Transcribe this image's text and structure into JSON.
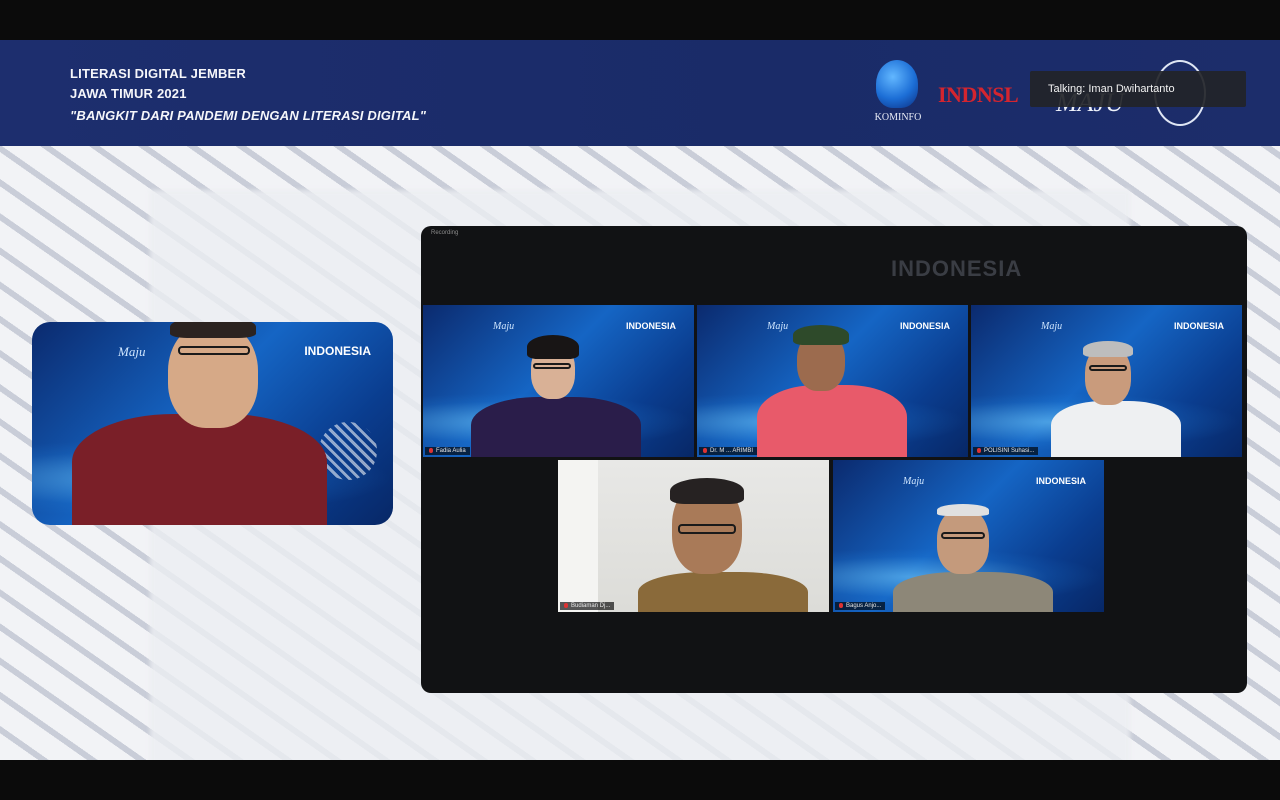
{
  "banner": {
    "line1": "LITERASI DIGITAL JEMBER",
    "line2": "JAWA TIMUR 2021",
    "line3": "\"BANGKIT DARI PANDEMI DENGAN LITERASI DIGITAL\"",
    "logos": {
      "kominfo": "KOMINFO",
      "siberkreasi": "INDNSL",
      "maju": "MAJU"
    }
  },
  "talking_indicator": "Talking: Iman Dwihartanto",
  "speaker_tile": {
    "bg_title": "INDONESIA",
    "bg_maju": "Maju"
  },
  "gallery": {
    "label": "Recording",
    "watermark": "INDONESIA",
    "participants": [
      {
        "name": "Fadia Aulia",
        "bg_title": "INDONESIA",
        "bg_maju": "Maju"
      },
      {
        "name": "Dr. M ... ARIMBI",
        "bg_title": "INDONESIA",
        "bg_maju": "Maju"
      },
      {
        "name": "POLISINI Suhasi...",
        "bg_title": "INDONESIA",
        "bg_maju": "Maju"
      },
      {
        "name": "Budiaman Dj...",
        "bg_title": "",
        "bg_maju": ""
      },
      {
        "name": "Bagus Anjo...",
        "bg_title": "INDONESIA",
        "bg_maju": "Maju"
      }
    ]
  }
}
